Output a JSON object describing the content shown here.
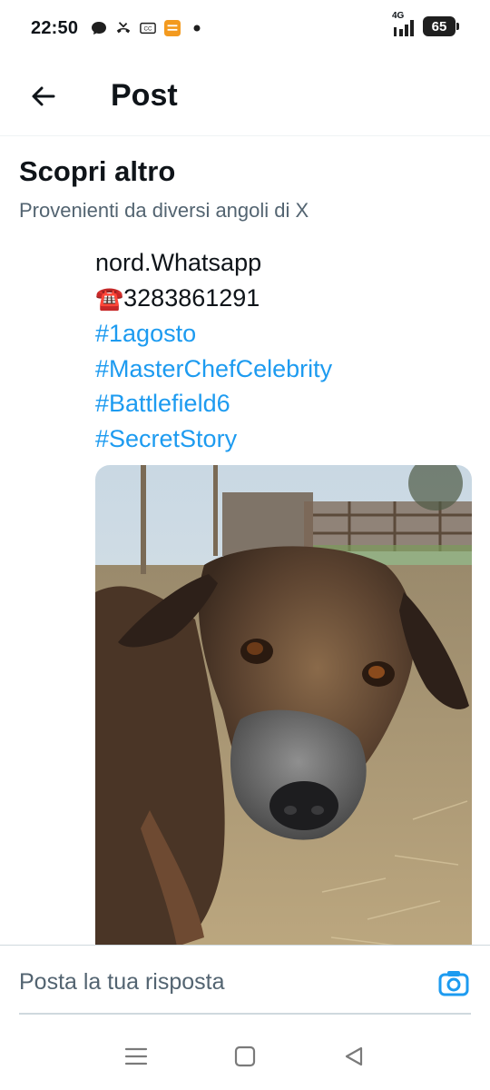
{
  "status_bar": {
    "time": "22:50",
    "network": "4G",
    "battery": "65",
    "icons": [
      "chat-bubble-icon",
      "missed-call-icon",
      "notification-icon",
      "app-icon",
      "dot-icon",
      "signal-icon",
      "battery-icon"
    ]
  },
  "header": {
    "back_icon": "arrow-left-icon",
    "title": "Post"
  },
  "discover": {
    "title": "Scopri altro",
    "subtitle": "Provenienti da diversi angoli di X"
  },
  "post": {
    "lines": [
      "nord.Whatsapp"
    ],
    "phone_emoji": "☎️",
    "phone_number": "3283861291",
    "hashtags": [
      "#1agosto",
      "#MasterChefCelebrity",
      "#Battlefield6",
      "#SecretStory"
    ],
    "media_subject": "dog-photo"
  },
  "reply": {
    "placeholder": "Posta la tua risposta",
    "camera_icon": "camera-icon"
  },
  "nav": {
    "items": [
      "menu-icon",
      "home-square-icon",
      "back-triangle-icon"
    ]
  },
  "colors": {
    "accent": "#1d9bf0",
    "text_primary": "#0f1419",
    "text_secondary": "#536471",
    "divider": "#cfd9de"
  }
}
